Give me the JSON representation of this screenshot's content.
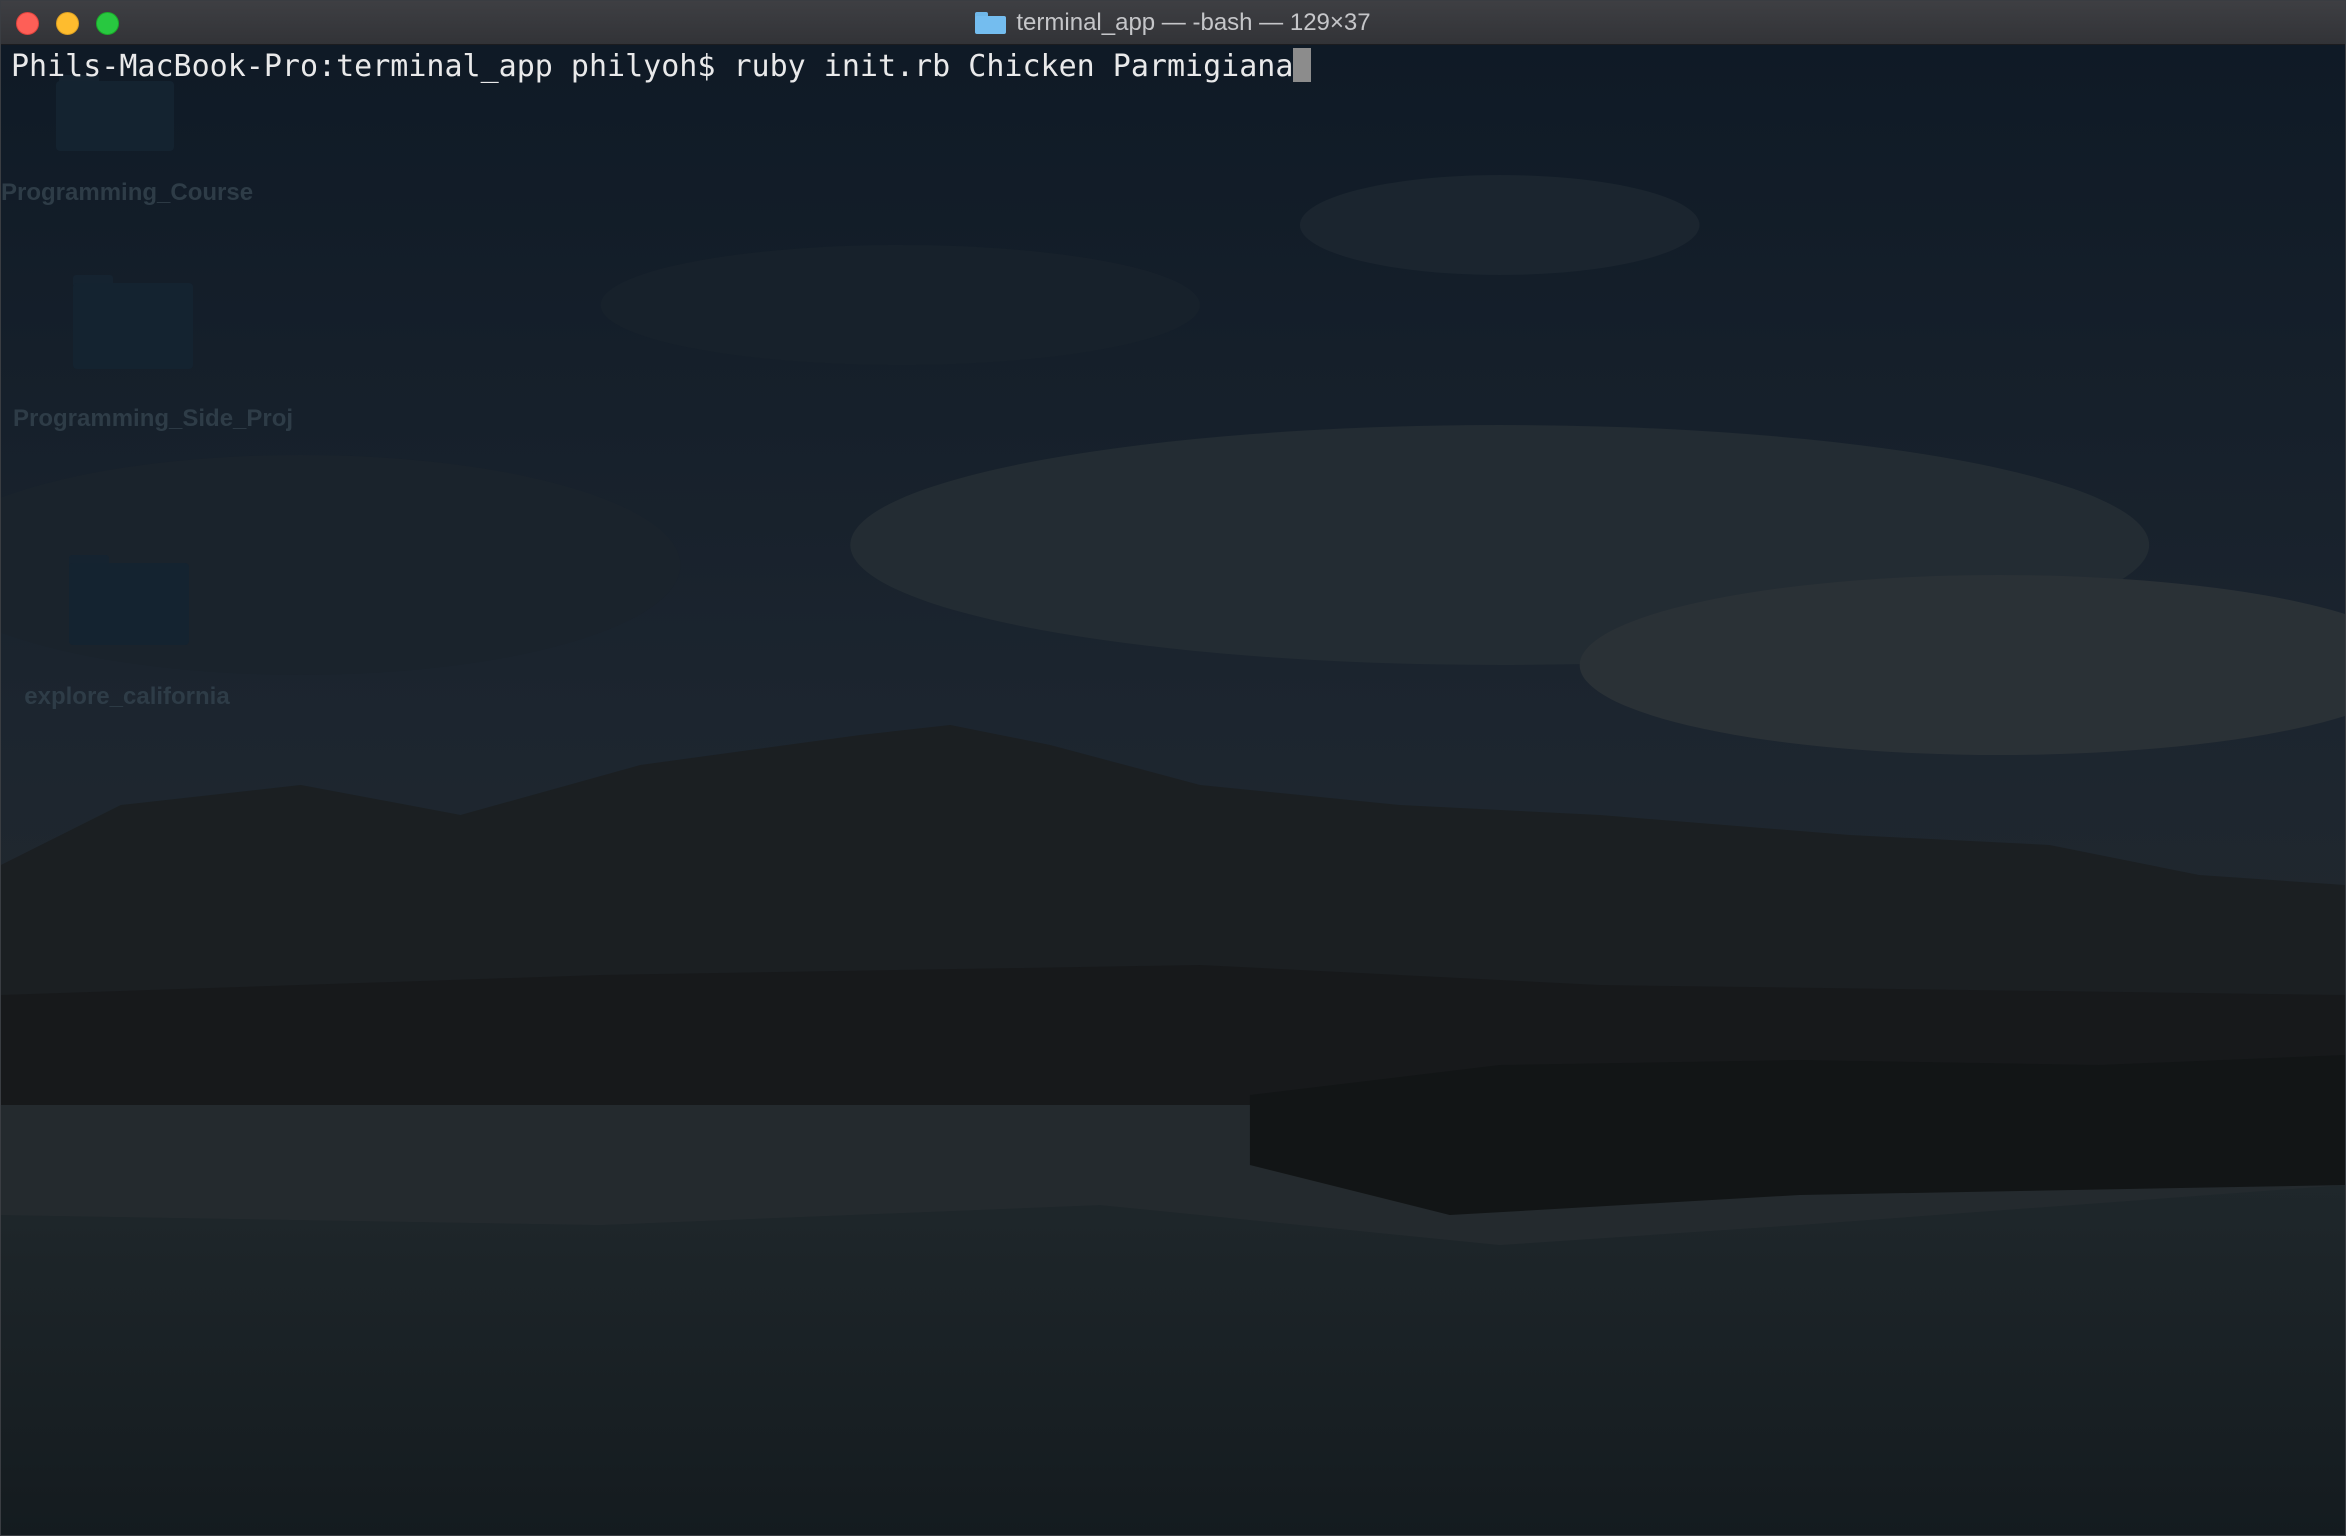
{
  "window": {
    "title": "terminal_app — -bash — 129×37",
    "folder_icon": "folder-icon"
  },
  "terminal": {
    "prompt": "Phils-MacBook-Pro:terminal_app philyoh$ ",
    "command": "ruby init.rb Chicken Parmigiana"
  },
  "desktop": {
    "icons": [
      {
        "label": "Programming_Course"
      },
      {
        "label": "Programming_Side_Proj"
      },
      {
        "label": "explore_california"
      }
    ]
  },
  "colors": {
    "close": "#fe5f57",
    "minimize": "#febc2e",
    "maximize": "#28c840",
    "text": "#e9e9ea"
  }
}
